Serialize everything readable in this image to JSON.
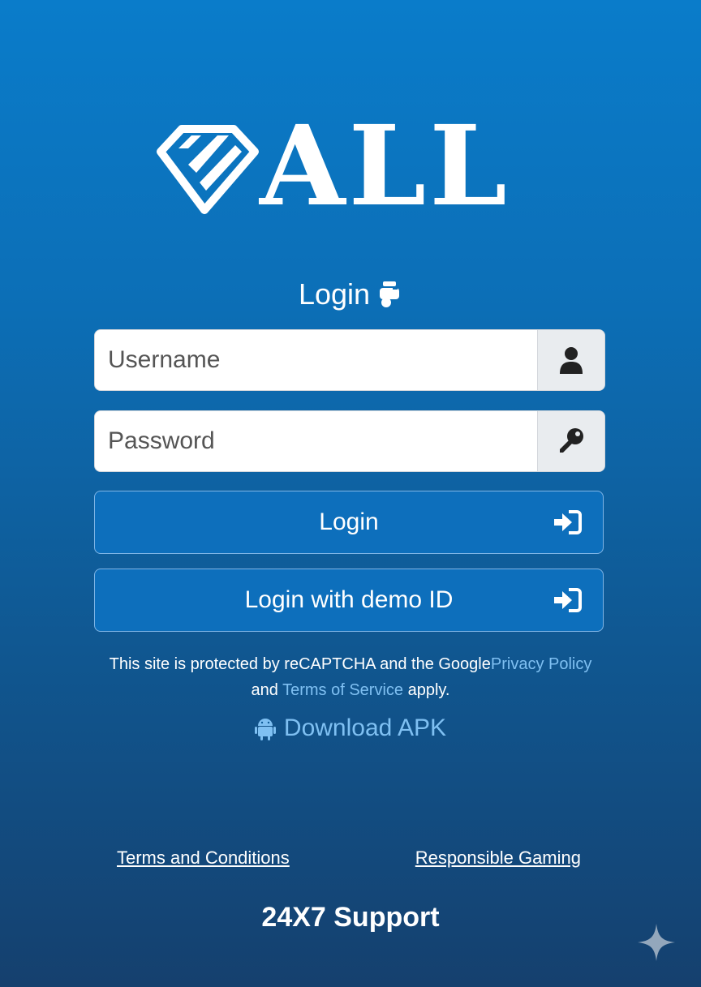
{
  "brand": {
    "name": "ALL"
  },
  "login": {
    "heading": "Login",
    "username_placeholder": "Username",
    "password_placeholder": "Password",
    "login_button": "Login",
    "demo_button": "Login with demo ID"
  },
  "recaptcha": {
    "prefix": "This site is protected by reCAPTCHA and the Google",
    "privacy_link": "Privacy Policy",
    "and": "and ",
    "terms_link": "Terms of Service",
    "suffix": " apply."
  },
  "apk": {
    "label": "Download APK"
  },
  "footer": {
    "terms": "Terms and Conditions",
    "responsible": "Responsible Gaming",
    "support": "24X7 Support"
  },
  "icons": {
    "logo": "diamond-logo-icon",
    "heading": "hand-pointing-down-icon",
    "username": "user-icon",
    "password": "key-icon",
    "login": "sign-in-icon",
    "apk": "android-icon",
    "corner": "sparkle-icon"
  },
  "colors": {
    "accent": "#0d6fbc",
    "link": "#7fc0f2"
  }
}
